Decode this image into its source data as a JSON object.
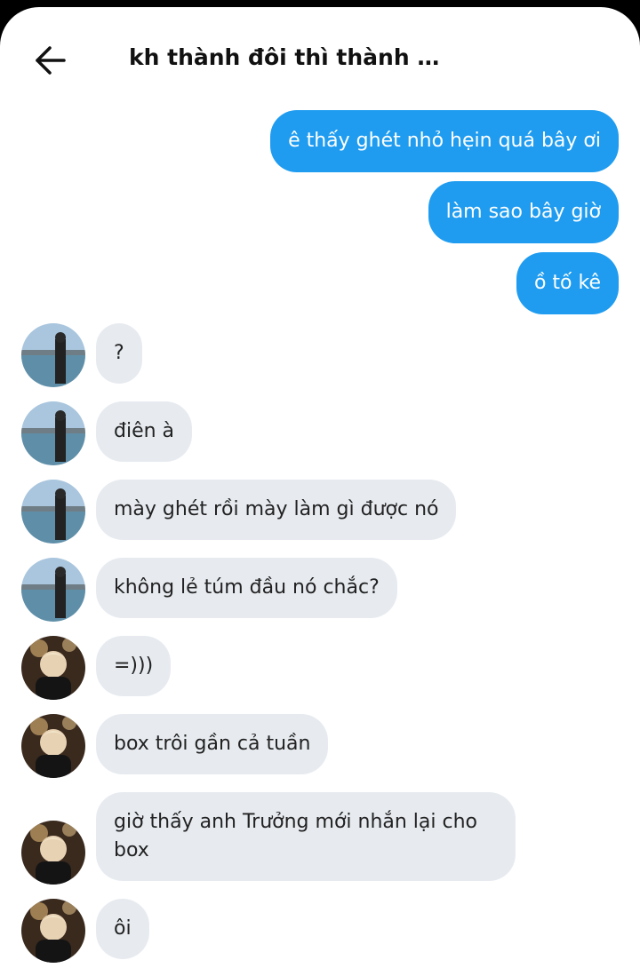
{
  "header": {
    "title": "kh thành đôi thì thành khú···"
  },
  "messages": {
    "m1": "ê thấy ghét nhỏ hẹin quá bây ơi",
    "m2": "làm sao bây giờ",
    "m3": "ồ tố kê",
    "m4": "?",
    "m5": "điên à",
    "m6": "mày ghét rồi mày làm gì được nó",
    "m7": "không lẻ túm đầu nó chắc?",
    "m8": "=)))",
    "m9": "box trôi gần cả tuần",
    "m10": "giờ thấy anh Trưởng mới nhắn lại cho box",
    "m11": "ôi"
  },
  "colors": {
    "outgoing_bubble": "#1f9cf0",
    "incoming_bubble": "#e7ebf0"
  },
  "icons": {
    "back": "arrow-left-icon"
  }
}
